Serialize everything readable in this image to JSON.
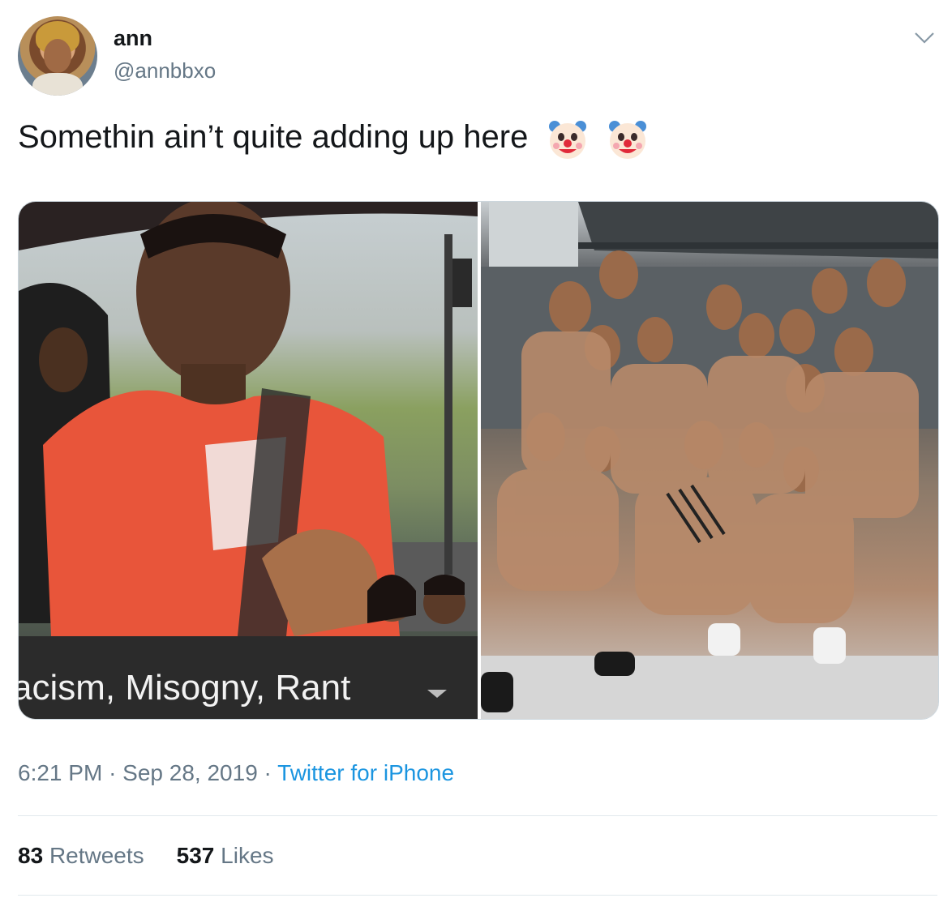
{
  "author": {
    "name": "ann",
    "handle": "@annbbxo"
  },
  "tweet": {
    "text": "Somethin ain’t quite adding up here",
    "emojis": [
      "clown-face",
      "clown-face"
    ]
  },
  "media": {
    "left_caption": "acism, Misogny, Rant",
    "dropdown_icon": "triangle-down-icon"
  },
  "meta": {
    "time": "6:21 PM",
    "separator": "·",
    "date": "Sep 28, 2019",
    "source": "Twitter for iPhone"
  },
  "stats": {
    "retweets_count": "83",
    "retweets_label": "Retweets",
    "likes_count": "537",
    "likes_label": "Likes"
  },
  "colors": {
    "text": "#14171a",
    "secondary": "#657786",
    "link": "#1b95e0",
    "border": "#e1e8ed"
  }
}
